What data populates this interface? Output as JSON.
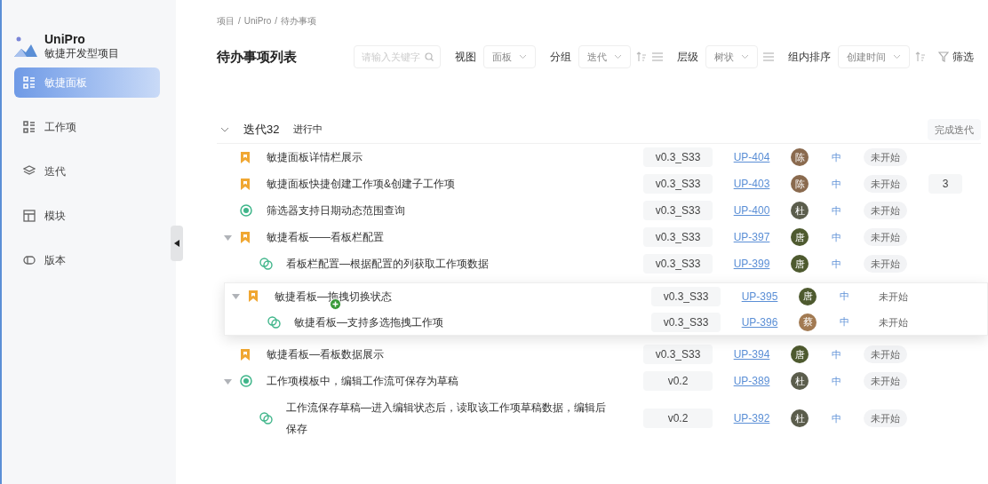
{
  "sidebar": {
    "app_name": "UniPro",
    "app_subtitle": "敏捷开发型项目",
    "items": [
      {
        "label": "敏捷面板",
        "selected": true
      },
      {
        "label": "工作项",
        "selected": false
      },
      {
        "label": "迭代",
        "selected": false
      },
      {
        "label": "模块",
        "selected": false
      },
      {
        "label": "版本",
        "selected": false
      }
    ]
  },
  "breadcrumb": {
    "separator": "/",
    "items": [
      "项目",
      "UniPro",
      "待办事项"
    ]
  },
  "page_title": "待办事项列表",
  "search": {
    "placeholder": "请输入关键字"
  },
  "toolbar": [
    {
      "label": "视图",
      "value": "面板"
    },
    {
      "label": "分组",
      "value": "迭代"
    },
    {
      "label": "层级",
      "value": "树状"
    },
    {
      "label": "组内排序",
      "value": "创建时间"
    }
  ],
  "filter_button": "筛选",
  "group": {
    "name": "迭代32",
    "status": "进行中",
    "expanded": true,
    "action": "完成迭代"
  },
  "rows": [
    {
      "kind": "story",
      "title": "敏捷面板详情栏展示",
      "version": "v0.3_S33",
      "id": "UP-404",
      "owner": "陈",
      "color": "#8a6a4e",
      "priority": "中",
      "status": "未开始"
    },
    {
      "kind": "story",
      "title": "敏捷面板快捷创建工作项&创建子工作项",
      "version": "v0.3_S33",
      "id": "UP-403",
      "owner": "陈",
      "color": "#8a6a4e",
      "priority": "中",
      "status": "未开始",
      "count": "3"
    },
    {
      "kind": "task",
      "title": "筛选器支持日期动态范围查询",
      "version": "v0.3_S33",
      "id": "UP-400",
      "owner": "杜",
      "color": "#5b5d4c",
      "priority": "中",
      "status": "未开始"
    },
    {
      "kind": "story",
      "title": "敏捷看板——看板栏配置",
      "version": "v0.3_S33",
      "id": "UP-397",
      "owner": "唐",
      "color": "#4e5a2f",
      "priority": "中",
      "status": "未开始",
      "expanded": true,
      "children": [
        {
          "kind": "subtask",
          "title": "看板栏配置—根据配置的列获取工作项数据",
          "version": "v0.3_S33",
          "id": "UP-399",
          "owner": "唐",
          "color": "#4e5a2f",
          "priority": "中",
          "status": "未开始"
        }
      ]
    }
  ],
  "drag_preview": [
    {
      "kind": "story",
      "title": "敏捷看板—拖拽切换状态",
      "version": "v0.3_S33",
      "id": "UP-395",
      "owner": "唐",
      "color": "#4e5a2f",
      "priority": "中",
      "status": "未开始",
      "expanded": true,
      "children": [
        {
          "kind": "subtask",
          "title": "敏捷看板—支持多选拖拽工作项",
          "version": "v0.3_S33",
          "id": "UP-396",
          "owner": "蔡",
          "color": "#a27a52",
          "priority": "中",
          "status": "未开始"
        }
      ]
    }
  ],
  "rows_below": [
    {
      "kind": "story",
      "title": "敏捷看板—看板数据展示",
      "version": "v0.3_S33",
      "id": "UP-394",
      "owner": "唐",
      "color": "#4e5a2f",
      "priority": "中",
      "status": "未开始"
    },
    {
      "kind": "task",
      "title": "工作项模板中，编辑工作流可保存为草稿",
      "version": "v0.2",
      "id": "UP-389",
      "owner": "杜",
      "color": "#5b5d4c",
      "priority": "中",
      "status": "未开始",
      "expanded": true,
      "children": [
        {
          "kind": "subtask",
          "title": "工作流保存草稿—进入编辑状态后，读取该工作项草稿数据，编辑后保存",
          "version": "v0.2",
          "id": "UP-392",
          "owner": "杜",
          "color": "#5b5d4c",
          "priority": "中",
          "status": "未开始"
        }
      ]
    }
  ]
}
